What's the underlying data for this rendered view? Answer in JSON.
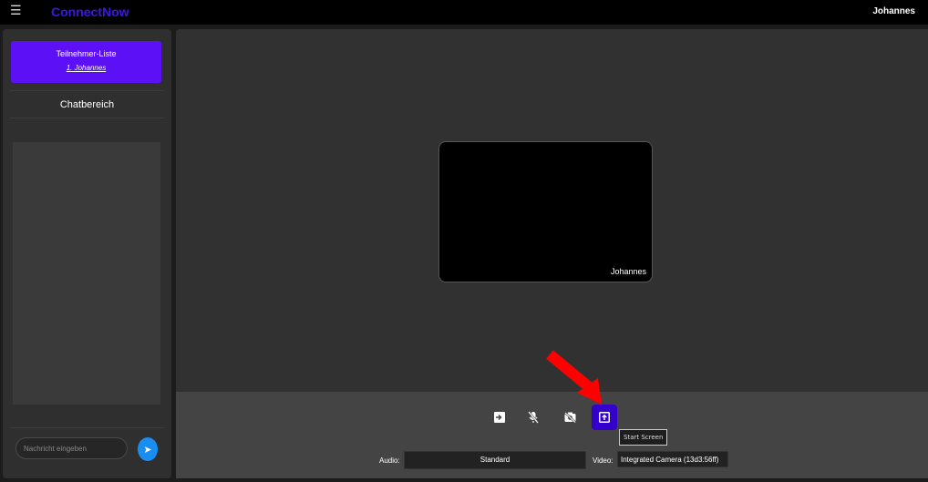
{
  "header": {
    "brand": "ConnectNow",
    "user": "Johannes"
  },
  "sidebar": {
    "participants_title": "Teilnehmer-Liste",
    "participants": [
      "1. Johannes"
    ],
    "chat_title": "Chatbereich",
    "message_placeholder": "Nachricht eingeben"
  },
  "video": {
    "tile_name": "Johannes"
  },
  "controls": {
    "buttons": [
      {
        "icon": "leave-icon",
        "active": false
      },
      {
        "icon": "mic-off-icon",
        "active": false
      },
      {
        "icon": "camera-off-icon",
        "active": false
      },
      {
        "icon": "screen-share-icon",
        "active": true
      }
    ],
    "tooltip": "Start Screen",
    "audio_label": "Audio:",
    "audio_value": "Standard",
    "video_label": "Video:",
    "video_value": "Integrated Camera (13d3:56ff)"
  },
  "colors": {
    "brand": "#3d16e8",
    "participants_bg": "#5c10f5",
    "active_button": "#3300cc",
    "send_button": "#1a8ef0",
    "arrow": "#ff0000"
  }
}
